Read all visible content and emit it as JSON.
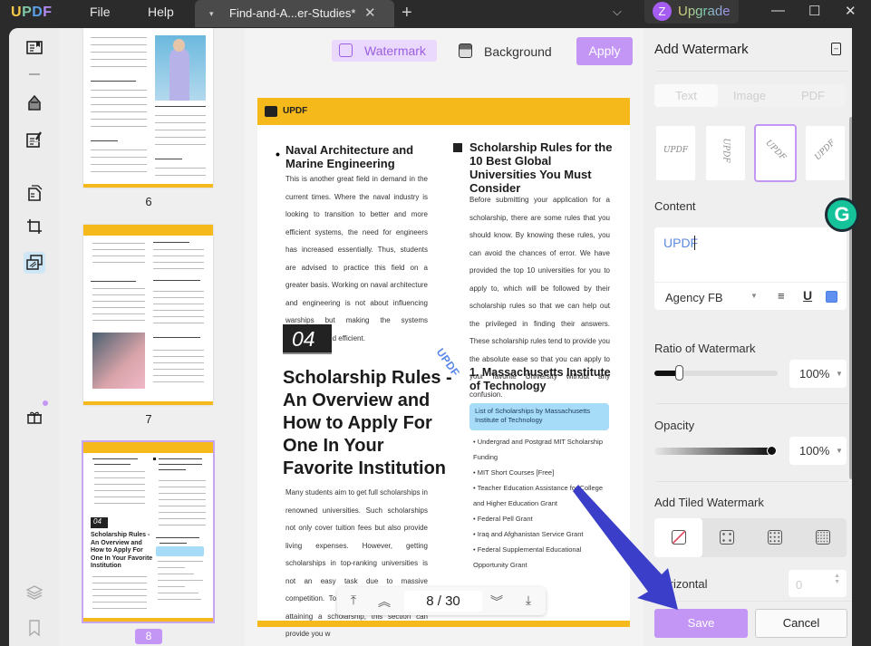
{
  "titlebar": {
    "logo": [
      "U",
      "P",
      "D",
      "F"
    ],
    "menu": [
      "File",
      "Help"
    ],
    "tab_name": "Find-and-A...er-Studies*",
    "upgrade_initial": "Z",
    "upgrade_label": "Upgrade",
    "icons": {
      "tab_dropdown": "▾",
      "tab_close": "✕",
      "new_tab": "+",
      "tabs_list": "⌵",
      "minimize": "—",
      "maximize": "☐",
      "close": "✕"
    }
  },
  "left_toolbar": {
    "tools": [
      "reader-icon",
      "highlight-icon",
      "edit-icon",
      "organize-pages-icon",
      "crop-icon",
      "watermark-background-icon"
    ],
    "active": "watermark-background-icon",
    "bottom": [
      "gift-icon",
      "layers-icon",
      "bookmark-icon"
    ]
  },
  "thumbnails": {
    "pages": [
      "6",
      "7",
      "8"
    ],
    "selected": "8"
  },
  "main_toolbar": {
    "watermark_label": "Watermark",
    "background_label": "Background",
    "apply_label": "Apply"
  },
  "document": {
    "header_brand": "UPDF",
    "left_heading": "Naval Architecture and Marine Engineering",
    "left_body": "This is another great field in demand in the current times. Where the naval industry is looking to transition to better and more efficient systems, the need for engineers has increased essentially. Thus, students are advised to practice this field on a greater basis. Working on naval architecture and engineering is not about influencing warships but making the systems sustainable and efficient.",
    "section_number": "04",
    "big_heading": "Scholarship Rules - An Overview and How to Apply For One In Your Favorite Institution",
    "left_body2": "Many students aim to get full scholarships in renowned universities. Such scholarships not only cover tuition fees but also provide living expenses. However, getting scholarships in top-ranking universities is not an easy task due to massive competition. To increase your chances of attaining a scholarship, this section can provide you w",
    "right_heading": "Scholarship Rules for the 10 Best Global Universities You Must Consider",
    "right_body": "Before submitting your application for a scholarship, there are some rules that you should know. By knowing these rules, you can avoid the chances of error. We have provided the top 10 universities for you to apply to, which will be followed by their scholarship rules so that we can help out the privileged in finding their answers. These scholarship rules tend to provide you the absolute ease so that you can apply to your favorite University without any confusion.",
    "mit_heading": "1. Massachusetts Institute of Technology",
    "list_box": "List of Scholarships by Massachusetts Institute of Technology",
    "list_items": [
      "Undergrad and Postgrad MIT Scholarship Funding",
      "MIT Short Courses [Free]",
      "Teacher Education Assistance for College and Higher Education Grant",
      "Federal Pell Grant",
      "Iraq and Afghanistan Service Grant",
      "Federal Supplemental Educational Opportunity Grant"
    ],
    "watermark_text": "UPDF"
  },
  "pager": {
    "current": "8",
    "separator": "/",
    "total": "30",
    "label": "8 / 30"
  },
  "panel": {
    "title": "Add Watermark",
    "source_tabs": [
      "Text",
      "Image",
      "PDF"
    ],
    "active_source": "Text",
    "style_previews": [
      "UPDF",
      "UPDF",
      "UPDF",
      "UPDF"
    ],
    "selected_style_index": 2,
    "content_label": "Content",
    "content_value": "UPDF",
    "font": "Agency FB",
    "text_color": "#5f90f0",
    "ratio_label": "Ratio of Watermark",
    "ratio_value": "100%",
    "ratio_slider_fraction": 0.2,
    "opacity_label": "Opacity",
    "opacity_value": "100%",
    "opacity_slider_fraction": 1.0,
    "tiled_label": "Add Tiled Watermark",
    "tiled_options": [
      "none",
      "2x2",
      "3x3",
      "4x4"
    ],
    "tiled_selected": "none",
    "horizontal_label": "Horizontal",
    "horizontal_value": "0",
    "save_label": "Save",
    "cancel_label": "Cancel"
  },
  "colors": {
    "accent": "#c396f5",
    "doc_yellow": "#f6b91b",
    "annotation_arrow": "#3a3ec8"
  }
}
